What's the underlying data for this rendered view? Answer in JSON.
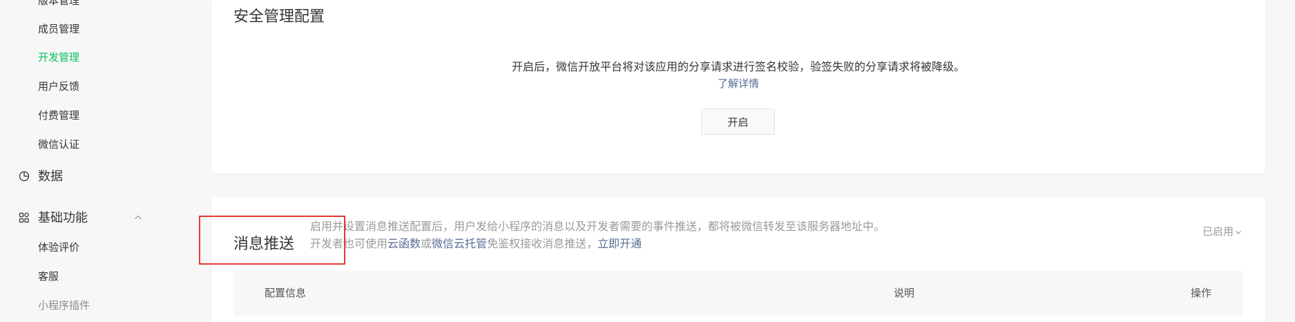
{
  "colors": {
    "accent": "#07c160",
    "link": "#576b95",
    "highlight": "#e53935"
  },
  "sidebar": {
    "dev_items": [
      "版本管理",
      "成员管理",
      "开发管理",
      "用户反馈",
      "付费管理",
      "微信认证"
    ],
    "active_item": "开发管理",
    "data_section": {
      "label": "数据",
      "icon": "pie-chart-icon"
    },
    "basic_section": {
      "label": "基础功能",
      "icon": "grid-icon",
      "expanded": true,
      "toggle_icon": "chevron-up-icon",
      "items": [
        "体验评价",
        "客服",
        "小程序插件"
      ]
    }
  },
  "security_card": {
    "title": "安全管理配置",
    "description": "开启后，微信开放平台将对该应用的分享请求进行签名校验，验签失败的分享请求将被降级。",
    "learn_more": "了解详情",
    "enable_button": "开启"
  },
  "message_push_card": {
    "title": "消息推送",
    "description_line1": "启用并设置消息推送配置后，用户发给小程序的消息以及开发者需要的事件推送，都将被微信转发至该服务器地址中。",
    "line2_prefix": "开发者也可使用",
    "cloud_function_link": "云函数",
    "or_text": "或",
    "cloud_hosting_link": "微信云托管",
    "line2_suffix": "免鉴权接收消息推送，",
    "enable_link": "立即开通",
    "status": "已启用",
    "status_icon": "chevron-down-icon",
    "table_headers": [
      "配置信息",
      "说明",
      "操作"
    ]
  }
}
